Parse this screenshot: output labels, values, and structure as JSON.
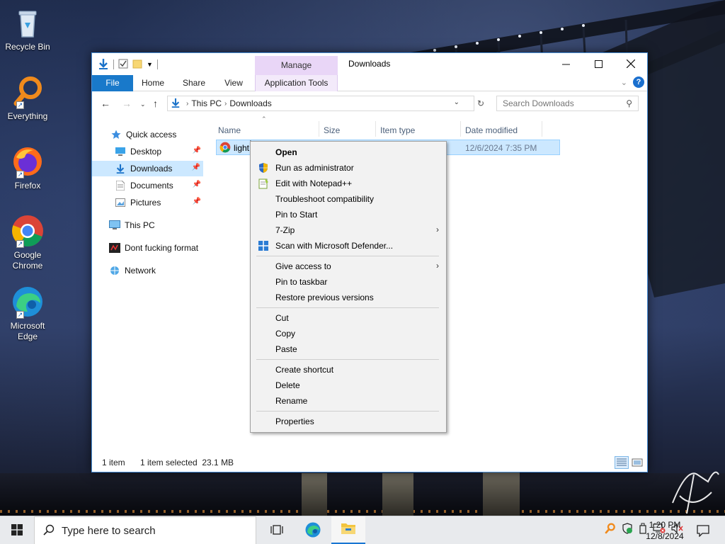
{
  "desktop": {
    "icons": [
      {
        "label": "Recycle Bin",
        "icon": "recycle-bin-icon"
      },
      {
        "label": "Everything",
        "icon": "everything-search-icon"
      },
      {
        "label": "Firefox",
        "icon": "firefox-icon"
      },
      {
        "label": "Google Chrome",
        "icon": "chrome-icon"
      },
      {
        "label": "Microsoft Edge",
        "icon": "edge-icon"
      }
    ]
  },
  "window": {
    "title": "Downloads",
    "manage_tab": "Manage",
    "ribbon_tabs": [
      "File",
      "Home",
      "Share",
      "View",
      "Application Tools"
    ],
    "address": {
      "segments": [
        "This PC",
        "Downloads"
      ]
    },
    "search": {
      "placeholder": "Search Downloads"
    },
    "nav_pane": [
      {
        "label": "Quick access",
        "icon": "star-icon",
        "pinned": false
      },
      {
        "label": "Desktop",
        "icon": "desktop-folder-icon",
        "pinned": true
      },
      {
        "label": "Downloads",
        "icon": "download-arrow-icon",
        "pinned": true,
        "selected": true
      },
      {
        "label": "Documents",
        "icon": "document-icon",
        "pinned": true
      },
      {
        "label": "Pictures",
        "icon": "pictures-icon",
        "pinned": true
      },
      {
        "label": "This PC",
        "icon": "computer-icon",
        "pinned": false
      },
      {
        "label": "Dont fucking format",
        "icon": "drive-icon",
        "pinned": false
      },
      {
        "label": "Network",
        "icon": "network-icon",
        "pinned": false
      }
    ],
    "columns": [
      "Name",
      "Size",
      "Item type",
      "Date modified"
    ],
    "files": [
      {
        "name": "light",
        "date_modified": "12/6/2024 7:35 PM",
        "icon": "chrome-icon"
      }
    ],
    "status": {
      "count": "1 item",
      "selection": "1 item selected  23.1 MB"
    }
  },
  "context_menu": {
    "items": [
      {
        "label": "Open",
        "bold": true,
        "icon": null
      },
      {
        "label": "Run as administrator",
        "icon": "shield-icon"
      },
      {
        "label": "Edit with Notepad++",
        "icon": "notepad-plus-plus-icon"
      },
      {
        "label": "Troubleshoot compatibility",
        "icon": null
      },
      {
        "label": "Pin to Start",
        "icon": null
      },
      {
        "label": "7-Zip",
        "icon": null,
        "submenu": true
      },
      {
        "label": "Scan with Microsoft Defender...",
        "icon": "defender-icon"
      },
      {
        "label": "Give access to",
        "icon": null,
        "submenu": true
      },
      {
        "label": "Pin to taskbar",
        "icon": null
      },
      {
        "label": "Restore previous versions",
        "icon": null
      },
      {
        "label": "Cut",
        "icon": null
      },
      {
        "label": "Copy",
        "icon": null
      },
      {
        "label": "Paste",
        "icon": null
      },
      {
        "label": "Create shortcut",
        "icon": null
      },
      {
        "label": "Delete",
        "icon": null
      },
      {
        "label": "Rename",
        "icon": null
      },
      {
        "label": "Properties",
        "icon": null
      }
    ]
  },
  "taskbar": {
    "search_placeholder": "Type here to search",
    "clock": {
      "time": "1:20 PM",
      "date": "12/8/2024"
    }
  },
  "colors": {
    "accent": "#1979ca",
    "selection": "#cce8ff",
    "manage_tab": "#e9d6f7"
  }
}
